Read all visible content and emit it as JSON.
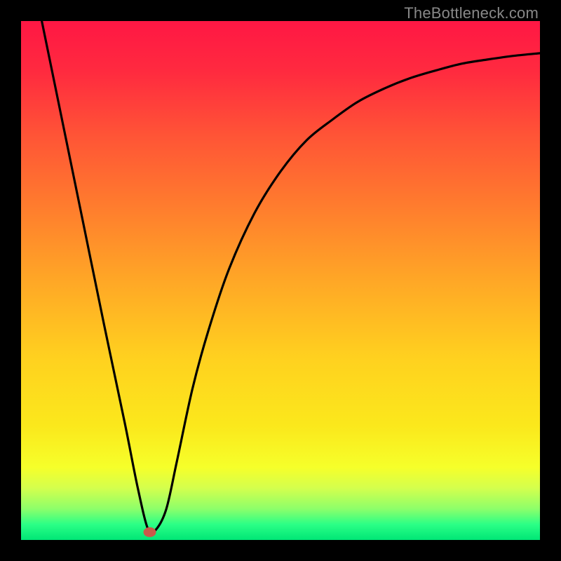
{
  "watermark": "TheBottleneck.com",
  "gradient": {
    "stops": [
      {
        "offset": 0.0,
        "color": "#ff1744"
      },
      {
        "offset": 0.1,
        "color": "#ff2b3f"
      },
      {
        "offset": 0.22,
        "color": "#ff5436"
      },
      {
        "offset": 0.35,
        "color": "#ff7a2e"
      },
      {
        "offset": 0.5,
        "color": "#ffa726"
      },
      {
        "offset": 0.65,
        "color": "#ffd11f"
      },
      {
        "offset": 0.78,
        "color": "#fbe81c"
      },
      {
        "offset": 0.86,
        "color": "#f6ff2a"
      },
      {
        "offset": 0.9,
        "color": "#d4ff4d"
      },
      {
        "offset": 0.94,
        "color": "#8dff6a"
      },
      {
        "offset": 0.97,
        "color": "#2bff86"
      },
      {
        "offset": 1.0,
        "color": "#00e676"
      }
    ]
  },
  "marker": {
    "x_frac": 0.248,
    "y_frac": 0.985,
    "rx": 9,
    "ry": 7,
    "color": "#c95a4a"
  },
  "chart_data": {
    "type": "line",
    "title": "",
    "xlabel": "",
    "ylabel": "",
    "x_range": [
      0,
      1
    ],
    "y_range": [
      0,
      1
    ],
    "note": "Axes are unlabeled; values are fractional coordinates of the plotted curve read directly from the image. y=1 is top, y=0 is bottom.",
    "series": [
      {
        "name": "curve",
        "x": [
          0.04,
          0.08,
          0.12,
          0.16,
          0.2,
          0.225,
          0.245,
          0.26,
          0.28,
          0.3,
          0.33,
          0.36,
          0.4,
          0.45,
          0.5,
          0.55,
          0.6,
          0.65,
          0.7,
          0.75,
          0.8,
          0.85,
          0.9,
          0.95,
          1.0
        ],
        "y": [
          1.0,
          0.805,
          0.61,
          0.415,
          0.225,
          0.1,
          0.02,
          0.02,
          0.06,
          0.15,
          0.29,
          0.4,
          0.52,
          0.63,
          0.71,
          0.77,
          0.81,
          0.845,
          0.87,
          0.89,
          0.905,
          0.918,
          0.926,
          0.933,
          0.938
        ]
      }
    ],
    "marker_point": {
      "x": 0.248,
      "y": 0.015
    }
  }
}
